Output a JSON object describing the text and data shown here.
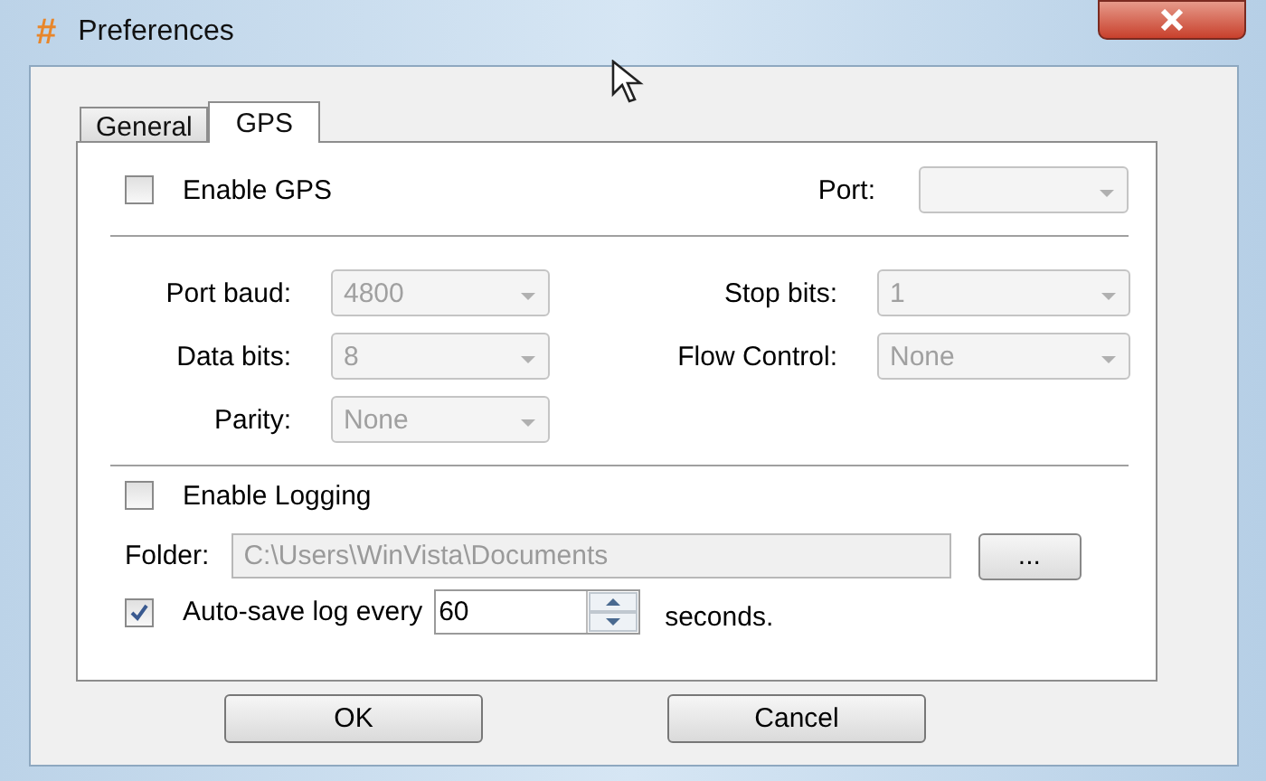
{
  "window": {
    "title": "Preferences",
    "app_glyph": "#"
  },
  "tabs": [
    {
      "label": "General",
      "selected": false
    },
    {
      "label": "GPS",
      "selected": true
    }
  ],
  "gps": {
    "enable": {
      "label": "Enable GPS",
      "checked": false
    },
    "port": {
      "label": "Port:",
      "disabled": true
    }
  },
  "serial": [
    {
      "label": "Port baud:",
      "value": "4800",
      "disabled": true
    },
    {
      "label": "Stop bits:",
      "value": "1",
      "disabled": true
    },
    {
      "label": "Data bits:",
      "value": "8",
      "disabled": true
    },
    {
      "label": "Flow Control:",
      "value": "None",
      "disabled": true
    },
    {
      "label": "Parity:",
      "value": "None",
      "disabled": true
    }
  ],
  "logging": {
    "enable": {
      "label": "Enable Logging",
      "checked": false
    },
    "folder": {
      "label": "Folder:",
      "value": "C:\\Users\\WinVista\\Documents",
      "disabled": true
    },
    "browse": "...",
    "autosave": {
      "label": "Auto-save log every",
      "checked": true
    },
    "interval": "60",
    "unit": "seconds."
  },
  "buttons": [
    "OK",
    "Cancel"
  ]
}
